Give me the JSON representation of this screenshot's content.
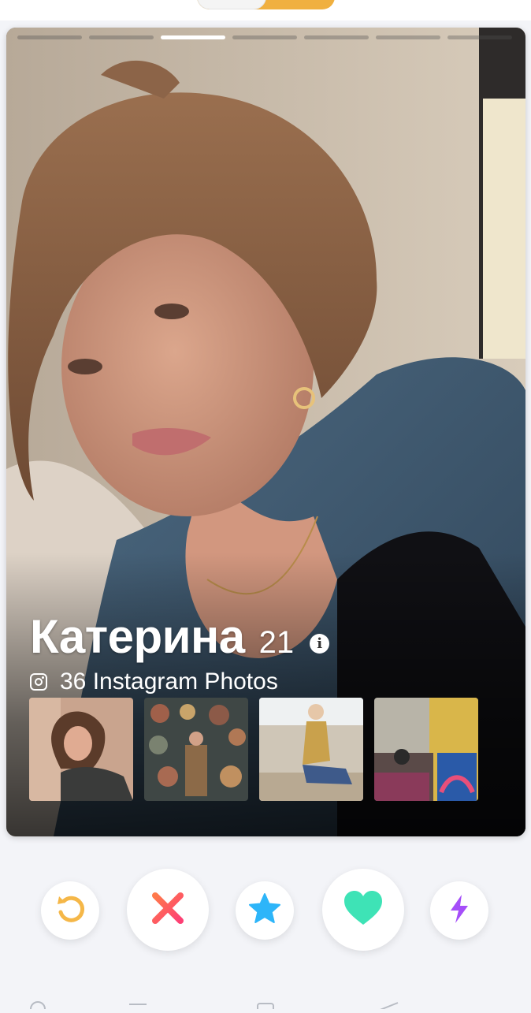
{
  "profile": {
    "name": "Катерина",
    "age": "21",
    "instagram_label": "36 Instagram Photos",
    "photo_count": 7,
    "active_photo_index": 2
  },
  "icons": {
    "info": "info-icon",
    "instagram": "instagram-icon",
    "rewind": "rewind-icon",
    "nope": "close-x-icon",
    "super_like": "star-icon",
    "like": "heart-icon",
    "boost": "lightning-bolt-icon"
  },
  "colors": {
    "rewind": "#f5b748",
    "nope": "#fd5068",
    "super_like": "#2db5f9",
    "like": "#3ee3b6",
    "boost": "#a54ef9",
    "toggle_accent": "#f0b040"
  }
}
